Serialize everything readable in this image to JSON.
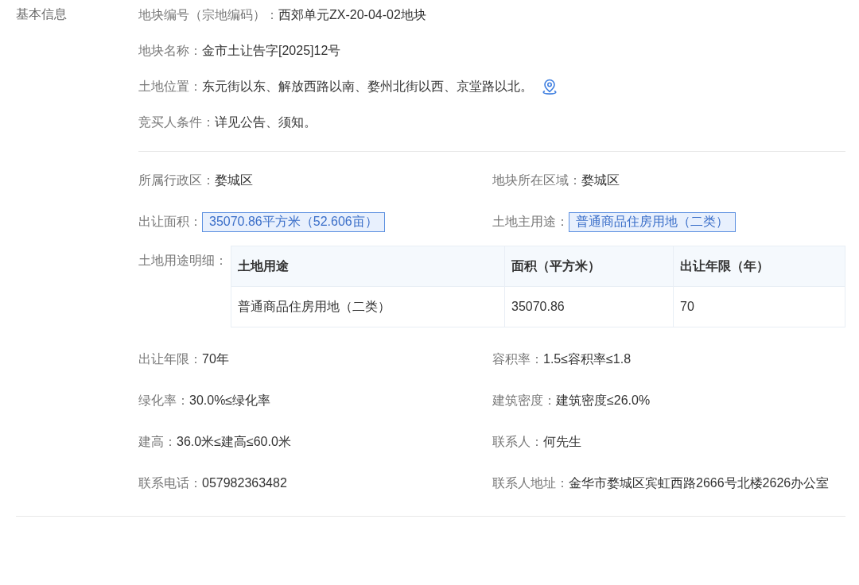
{
  "section": {
    "title": "基本信息"
  },
  "top_fields": [
    {
      "kind": "text",
      "label": "地块编号（宗地编码）：",
      "value": "西郊单元ZX-20-04-02地块"
    },
    {
      "kind": "text",
      "label": "地块名称：",
      "value": "金市土让告字[2025]12号"
    },
    {
      "kind": "location",
      "label": "土地位置：",
      "value": "东元街以东、解放西路以南、婺州北街以西、京堂路以北。"
    },
    {
      "kind": "text",
      "label": "竞买人条件：",
      "value": "详见公告、须知。"
    }
  ],
  "grid_items": [
    {
      "kind": "text",
      "label": "所属行政区：",
      "value": "婺城区"
    },
    {
      "kind": "text",
      "label": "地块所在区域：",
      "value": "婺城区"
    },
    {
      "kind": "tag",
      "label": "出让面积：",
      "value": "35070.86平方米（52.606亩）"
    },
    {
      "kind": "tag",
      "label": "土地主用途：",
      "value": "普通商品住房用地（二类）"
    },
    {
      "kind": "table",
      "label": "土地用途明细：",
      "columns": [
        "土地用途",
        "面积（平方米）",
        "出让年限（年）"
      ],
      "rows": [
        [
          "普通商品住房用地（二类）",
          "35070.86",
          "70"
        ]
      ]
    },
    {
      "kind": "text",
      "label": "出让年限：",
      "value": "70年"
    },
    {
      "kind": "text",
      "label": "容积率：",
      "value": "1.5≤容积率≤1.8"
    },
    {
      "kind": "text",
      "label": "绿化率：",
      "value": "30.0%≤绿化率"
    },
    {
      "kind": "text",
      "label": "建筑密度：",
      "value": "建筑密度≤26.0%"
    },
    {
      "kind": "text",
      "label": "建高：",
      "value": "36.0米≤建高≤60.0米"
    },
    {
      "kind": "text",
      "label": "联系人：",
      "value": "何先生"
    },
    {
      "kind": "text",
      "label": "联系电话：",
      "value": "057982363482"
    },
    {
      "kind": "text",
      "label": "联系人地址：",
      "value": "金华市婺城区宾虹西路2666号北楼2626办公室"
    }
  ]
}
